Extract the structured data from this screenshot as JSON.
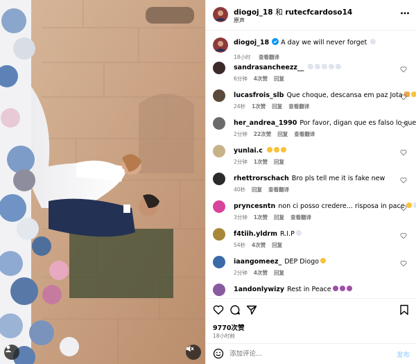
{
  "header": {
    "user1": "diogoj_18",
    "and_text": "和",
    "user2": "rutecfcardoso14",
    "subtitle": "原声",
    "more_icon": "more-horizontal-icon"
  },
  "caption": {
    "username": "diogoj_18",
    "text": "A day we will never forget",
    "time": "18小时",
    "translate": "查看翻译"
  },
  "comments": [
    {
      "username": "sandrasancheezz__",
      "text": "",
      "emojis": [
        "dove",
        "dove",
        "dove",
        "dove",
        "dove"
      ],
      "time": "6分钟",
      "likes": "4次赞",
      "reply": "回复",
      "translate": "",
      "avatar_color": "#3b2a2a"
    },
    {
      "username": "lucasfrois_slb",
      "text": "Que choque, descansa em paz Jota",
      "emojis": [
        "pray",
        "face"
      ],
      "time": "24秒",
      "likes": "1次赞",
      "reply": "回复",
      "translate": "查看翻译",
      "avatar_color": "#5a4a3a"
    },
    {
      "username": "her_andrea_1990",
      "text": "Por favor, digan que es falso lo que dicen",
      "emojis": [
        "pray"
      ],
      "time": "2分钟",
      "likes": "22次赞",
      "reply": "回复",
      "translate": "查看翻译",
      "avatar_color": "#6b6b6b"
    },
    {
      "username": "yunlai.c",
      "text": "",
      "emojis": [
        "face",
        "face",
        "face"
      ],
      "time": "2分钟",
      "likes": "1次赞",
      "reply": "回复",
      "translate": "",
      "avatar_color": "#c8b28a"
    },
    {
      "username": "rhettrorschach",
      "text": "Bro pls tell me it is fake new",
      "emojis": [],
      "time": "40秒",
      "likes": "",
      "reply": "回复",
      "translate": "查看翻译",
      "avatar_color": "#2b2b2b"
    },
    {
      "username": "pryncesntn",
      "text": "non ci posso credere... risposa in pace",
      "emojis": [
        "face",
        "dove"
      ],
      "time": "3分钟",
      "likes": "1次赞",
      "reply": "回复",
      "translate": "查看翻译",
      "avatar_color": "#d6459c"
    },
    {
      "username": "f4tiih.yldrm",
      "text": "R.I.P",
      "emojis": [
        "dove"
      ],
      "time": "54秒",
      "likes": "4次赞",
      "reply": "回复",
      "translate": "",
      "avatar_color": "#a8873a"
    },
    {
      "username": "iaangomeez_",
      "text": "DEP Diogo",
      "emojis": [
        "face"
      ],
      "time": "2分钟",
      "likes": "4次赞",
      "reply": "回复",
      "translate": "",
      "avatar_color": "#3a6aa8"
    },
    {
      "username": "1andonlywizy",
      "text": "Rest in Peace",
      "emojis": [
        "devil",
        "devil",
        "devil"
      ],
      "time": "",
      "likes": "",
      "reply": "",
      "translate": "",
      "avatar_color": "#8a5aa0"
    }
  ],
  "actions": {
    "like_icon": "heart-icon",
    "comment_icon": "comment-icon",
    "share_icon": "share-icon",
    "save_icon": "bookmark-icon",
    "likes_text": "9770次赞",
    "time_ago": "18小时前"
  },
  "add_comment": {
    "placeholder": "添加评论...",
    "post_label": "发布"
  },
  "colors": {
    "verified": "#0095f6",
    "meta_text": "#737373",
    "post_disabled": "#b3dbff"
  }
}
